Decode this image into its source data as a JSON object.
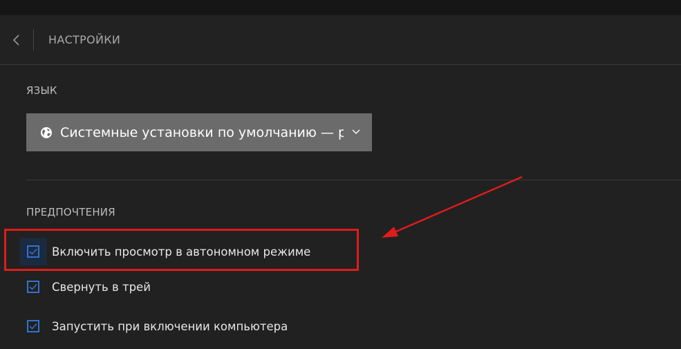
{
  "header": {
    "title": "НАСТРОЙКИ",
    "back_icon": "chevron-left-icon"
  },
  "language": {
    "section_label": "ЯЗЫК",
    "selected_value": "Системные установки по умолчанию — русский",
    "globe_icon": "globe-icon",
    "dropdown_icon": "chevron-down-icon"
  },
  "preferences": {
    "section_label": "ПРЕДПОЧТЕНИЯ",
    "items": [
      {
        "label": "Включить просмотр в автономном режиме",
        "checked": true
      },
      {
        "label": "Свернуть в трей",
        "checked": true
      },
      {
        "label": "Запустить при включении компьютера",
        "checked": true
      }
    ]
  },
  "annotation": {
    "highlight_color": "#e11b1b"
  },
  "colors": {
    "background": "#212121",
    "checkbox_accent": "#2f74d0",
    "select_background": "#6b6b6b"
  }
}
